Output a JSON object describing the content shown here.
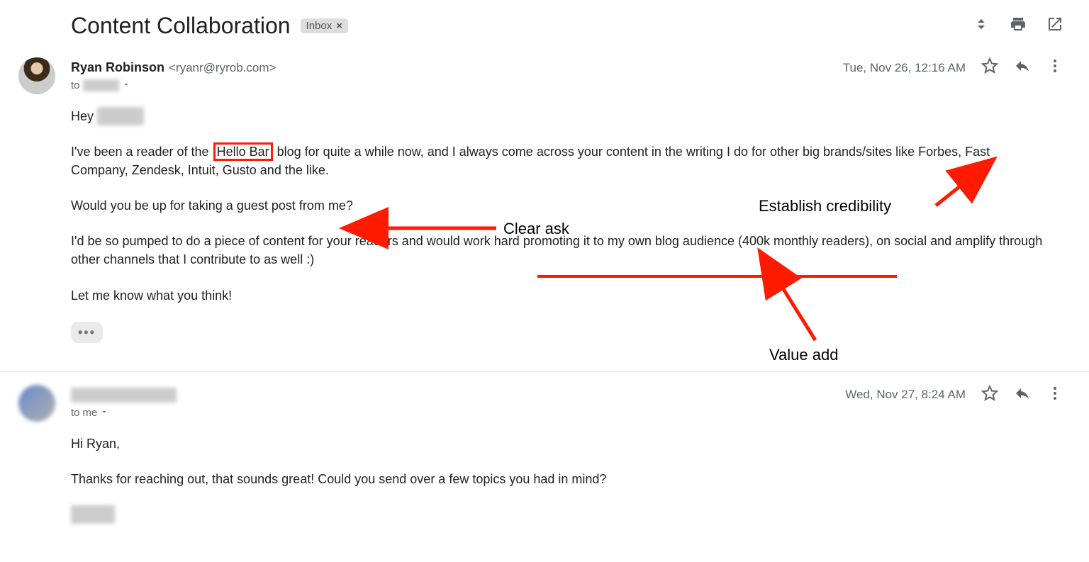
{
  "subject": "Content Collaboration",
  "label": {
    "name": "Inbox",
    "close": "×"
  },
  "msg1": {
    "sender_name": "Ryan Robinson",
    "sender_email": "<ryanr@ryrob.com>",
    "date": "Tue, Nov 26, 12:16 AM",
    "to_prefix": "to",
    "to_name_redacted": "Lindsey",
    "body": {
      "greet_prefix": "Hey ",
      "greet_name_redacted": "Lindsey,",
      "p1_a": "I've been a reader of the ",
      "p1_highlight": "Hello Bar",
      "p1_b": " blog for quite a while now, and I always come across your content in the writing I do for other big brands/sites like Forbes, Fast Company, Zendesk, Intuit, Gusto and the like.",
      "p2": "Would you be up for taking a guest post from me?",
      "p3": "I'd be so pumped to do a piece of content for your readers and would work hard promoting it to my own blog audience (400k monthly readers), on social and amplify through other channels that I contribute to as well :)",
      "p4": "Let me know what you think!"
    }
  },
  "msg2": {
    "sender_name_redacted": "Lindsey Morando",
    "date": "Wed, Nov 27, 8:24 AM",
    "to_prefix": "to",
    "to_name": "me",
    "body": {
      "p1": "Hi Ryan,",
      "p2": "Thanks for reaching out, that sounds great! Could you send over a few topics you had in mind?",
      "sig_redacted": "Lindsey"
    }
  },
  "annotations": {
    "credibility": "Establish credibility",
    "ask": "Clear ask",
    "value": "Value add"
  }
}
